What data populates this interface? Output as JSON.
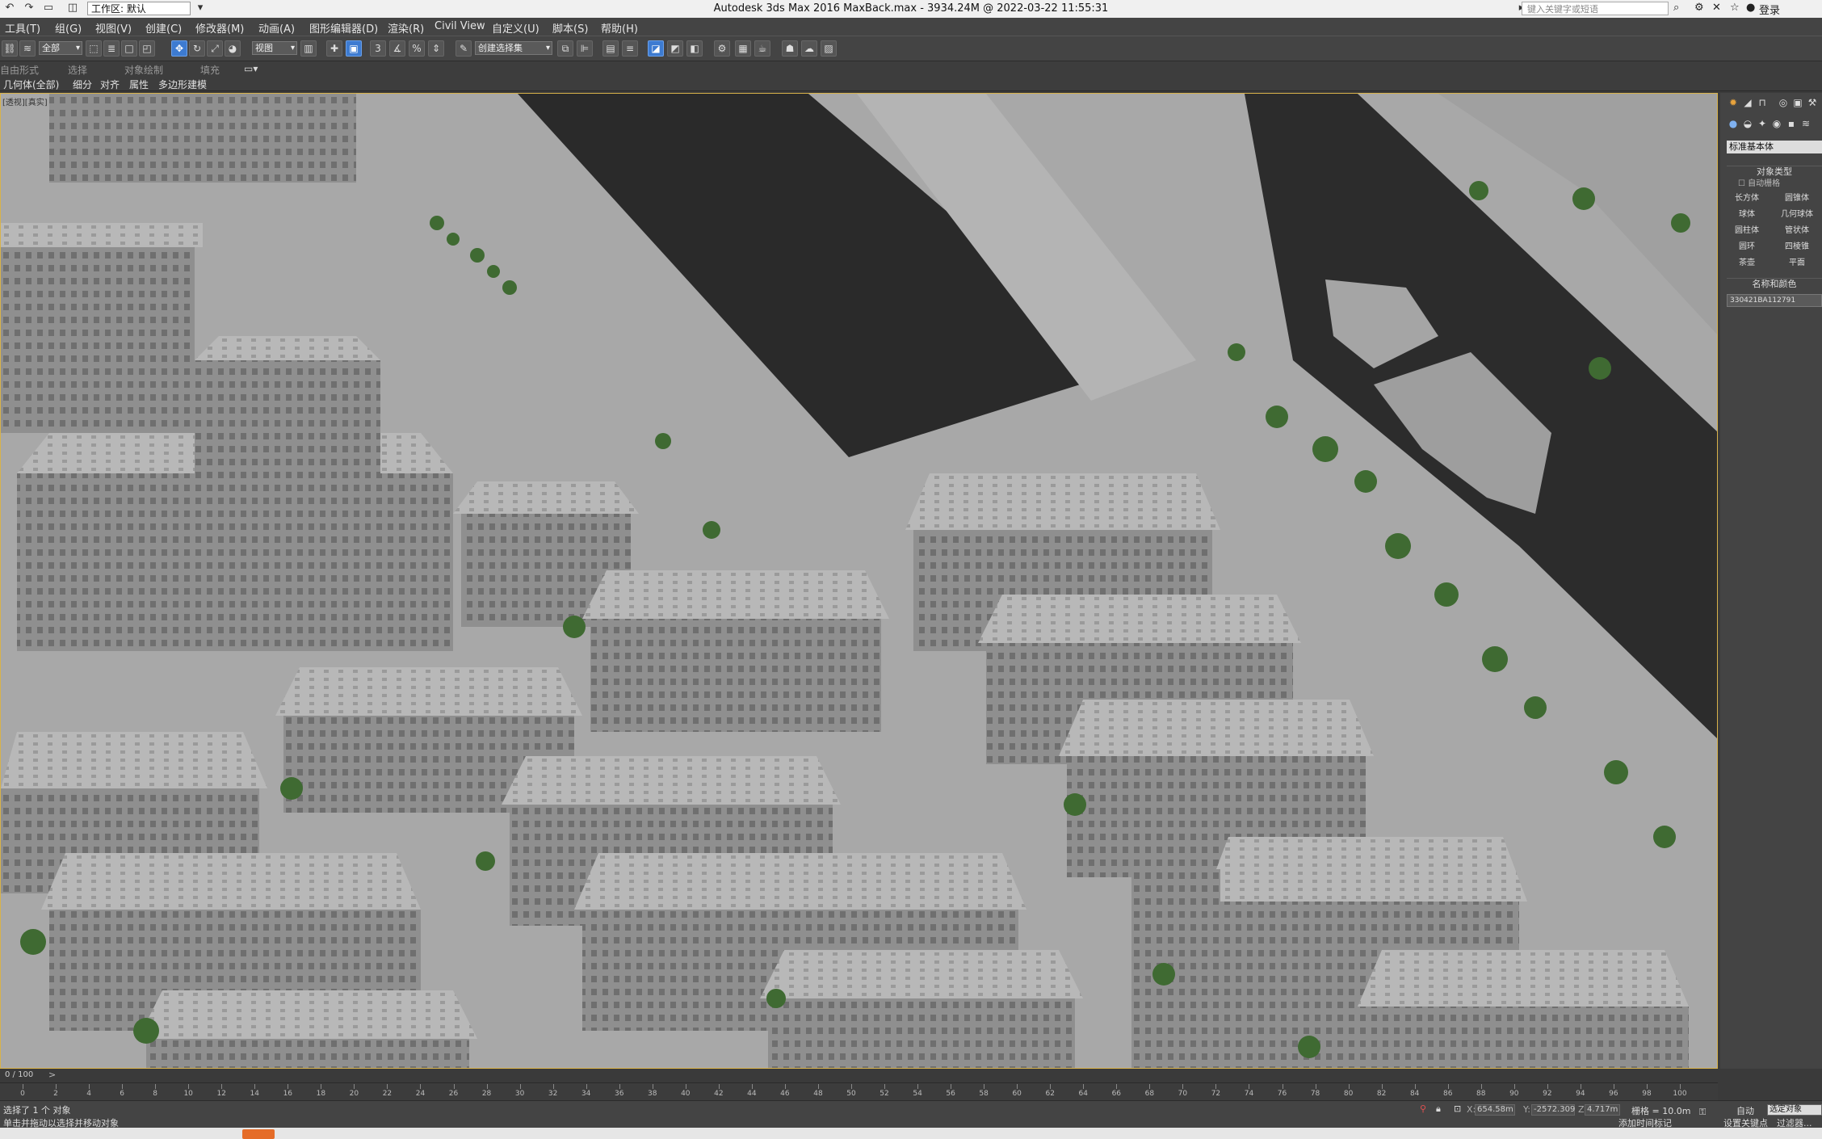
{
  "window": {
    "title": "Autodesk 3ds Max 2016      MaxBack.max - 3934.24M @ 2022-03-22 11:55:31",
    "workspace_label": "工作区: 默认",
    "search_placeholder": "键入关键字或短语",
    "login_label": "登录"
  },
  "menu": {
    "items": [
      "工具(T)",
      "组(G)",
      "视图(V)",
      "创建(C)",
      "修改器(M)",
      "动画(A)",
      "图形编辑器(D)",
      "渲染(R)",
      "Civil View",
      "自定义(U)",
      "脚本(S)",
      "帮助(H)"
    ]
  },
  "toolbar": {
    "selection_filter": "全部",
    "ref_coord": "视图",
    "named_selection": "创建选择集"
  },
  "ribbon": {
    "tabs": [
      "自由形式",
      "选择",
      "对象绘制",
      "填充"
    ],
    "sub_items": [
      "几何体(全部)",
      "细分",
      "对齐",
      "属性",
      "多边形建模"
    ]
  },
  "viewport": {
    "label": "[透视][真实]",
    "accent_color": "#d8b24a"
  },
  "command_panel": {
    "type_dropdown": "标准基本体",
    "object_type_header": "对象类型",
    "autogrid_label": "自动栅格",
    "buttons": [
      "长方体",
      "圆锥体",
      "球体",
      "几何球体",
      "圆柱体",
      "管状体",
      "圆环",
      "四棱锥",
      "茶壶",
      "平面"
    ],
    "name_color_header": "名称和颜色",
    "object_name": "330421BA112791"
  },
  "timeline": {
    "slider_label": "0 / 100",
    "ticks": [
      "0",
      "2",
      "4",
      "6",
      "8",
      "10",
      "12",
      "14",
      "16",
      "18",
      "20",
      "22",
      "24",
      "26",
      "28",
      "30",
      "32",
      "34",
      "36",
      "38",
      "40",
      "42",
      "44",
      "46",
      "48",
      "50",
      "52",
      "54",
      "56",
      "58",
      "60",
      "62",
      "64",
      "66",
      "68",
      "70",
      "72",
      "74",
      "76",
      "78",
      "80",
      "82",
      "84",
      "86",
      "88",
      "90",
      "92",
      "94",
      "96",
      "98",
      "100"
    ]
  },
  "status": {
    "selection_text": "选择了 1 个 对象",
    "prompt_text": "单击并拖动以选择并移动对象",
    "x_value": "654.58m",
    "y_value": "-2572.309",
    "z_value": "4.717m",
    "grid_text": "栅格 = 10.0m",
    "auto_label": "自动",
    "selected_label": "选定对象",
    "set_key_label": "设置关键点",
    "key_filters_label": "过滤器...",
    "add_time_tag": "添加时间标记"
  }
}
